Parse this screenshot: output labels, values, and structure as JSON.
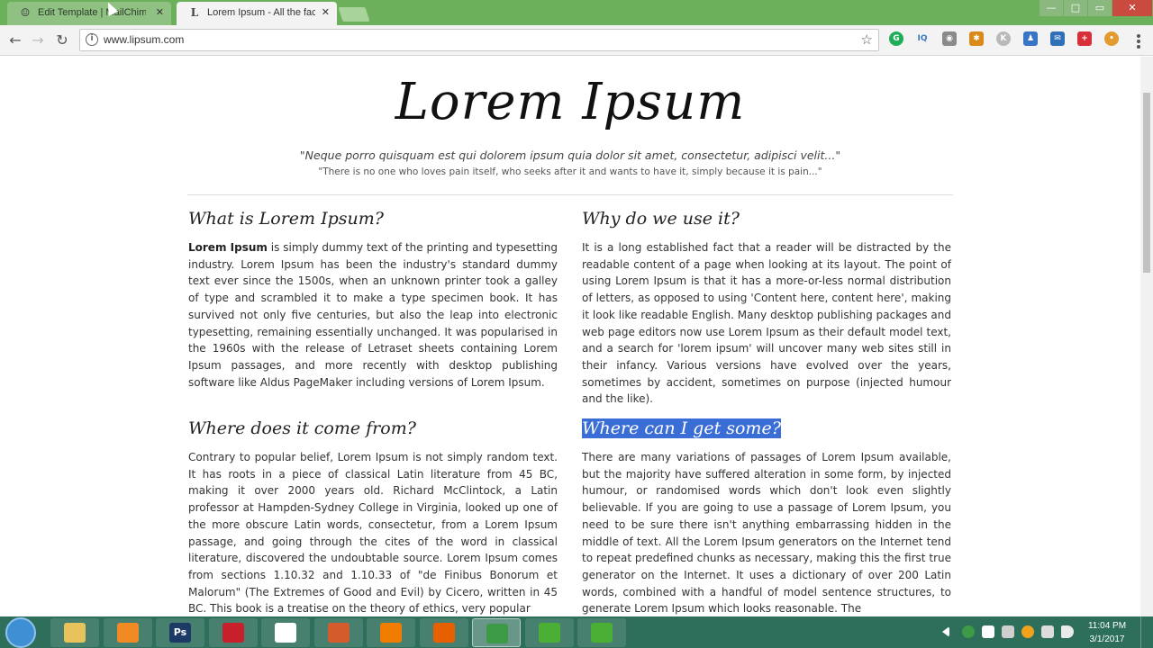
{
  "browser": {
    "tabs": [
      {
        "title": "Edit Template | MailChimp",
        "favicon": "mailchimp-icon",
        "active": false
      },
      {
        "title": "Lorem Ipsum - All the facts",
        "favicon": "L",
        "active": true
      }
    ],
    "close_glyph": "✕",
    "url": "www.lipsum.com",
    "window_controls": {
      "minimize": "—",
      "maximize": "□",
      "restore": "▭",
      "close": "✕"
    },
    "nav": {
      "back": "←",
      "forward": "→",
      "reload": "↻"
    },
    "extensions": [
      "grammarly-icon",
      "iq-icon",
      "camera-icon",
      "puzzle-icon",
      "k-icon",
      "user-icon",
      "mail-icon",
      "plus-icon",
      "cookie-icon"
    ],
    "extension_labels": {
      "iq": "IQ",
      "k": "K"
    }
  },
  "page": {
    "title": "Lorem Ipsum",
    "quote_latin": "\"Neque porro quisquam est qui dolorem ipsum quia dolor sit amet, consectetur, adipisci velit...\"",
    "quote_english": "\"There is no one who loves pain itself, who seeks after it and wants to have it, simply because it is pain...\"",
    "sections": [
      {
        "heading": "What is Lorem Ipsum?",
        "lead": "Lorem Ipsum",
        "body": " is simply dummy text of the printing and typesetting industry. Lorem Ipsum has been the industry's standard dummy text ever since the 1500s, when an unknown printer took a galley of type and scrambled it to make a type specimen book. It has survived not only five centuries, but also the leap into electronic typesetting, remaining essentially unchanged. It was popularised in the 1960s with the release of Letraset sheets containing Lorem Ipsum passages, and more recently with desktop publishing software like Aldus PageMaker including versions of Lorem Ipsum."
      },
      {
        "heading": "Why do we use it?",
        "body": "It is a long established fact that a reader will be distracted by the readable content of a page when looking at its layout. The point of using Lorem Ipsum is that it has a more-or-less normal distribution of letters, as opposed to using 'Content here, content here', making it look like readable English. Many desktop publishing packages and web page editors now use Lorem Ipsum as their default model text, and a search for 'lorem ipsum' will uncover many web sites still in their infancy. Various versions have evolved over the years, sometimes by accident, sometimes on purpose (injected humour and the like)."
      },
      {
        "heading": "Where does it come from?",
        "body": "Contrary to popular belief, Lorem Ipsum is not simply random text. It has roots in a piece of classical Latin literature from 45 BC, making it over 2000 years old. Richard McClintock, a Latin professor at Hampden-Sydney College in Virginia, looked up one of the more obscure Latin words, consectetur, from a Lorem Ipsum passage, and going through the cites of the word in classical literature, discovered the undoubtable source. Lorem Ipsum comes from sections 1.10.32 and 1.10.33 of \"de Finibus Bonorum et Malorum\" (The Extremes of Good and Evil) by Cicero, written in 45 BC. This book is a treatise on the theory of ethics, very popular"
      },
      {
        "heading": "Where can I get some?",
        "highlighted": true,
        "body": "There are many variations of passages of Lorem Ipsum available, but the majority have suffered alteration in some form, by injected humour, or randomised words which don't look even slightly believable. If you are going to use a passage of Lorem Ipsum, you need to be sure there isn't anything embarrassing hidden in the middle of text. All the Lorem Ipsum generators on the Internet tend to repeat predefined chunks as necessary, making this the first true generator on the Internet. It uses a dictionary of over 200 Latin words, combined with a handful of model sentence structures, to generate Lorem Ipsum which looks reasonable. The"
      }
    ]
  },
  "taskbar": {
    "items": [
      {
        "name": "explorer-icon",
        "color": "#e8c25a"
      },
      {
        "name": "media-player-icon",
        "color": "#f08a24"
      },
      {
        "name": "photoshop-icon",
        "color": "#1d3a67",
        "label": "Ps"
      },
      {
        "name": "downloader-icon",
        "color": "#c8202a"
      },
      {
        "name": "star-app-icon",
        "color": "#ffffff"
      },
      {
        "name": "image-viewer-icon",
        "color": "#d45b2c"
      },
      {
        "name": "vlc-icon",
        "color": "#f07c00"
      },
      {
        "name": "firefox-icon",
        "color": "#e66000"
      },
      {
        "name": "chrome-icon",
        "color": "#3d9b48"
      },
      {
        "name": "camtasia-icon",
        "color": "#4caf35"
      },
      {
        "name": "camtasia-recorder-icon",
        "color": "#4caf35"
      }
    ],
    "clock_time": "11:04 PM",
    "clock_date": "3/1/2017"
  },
  "colors": {
    "tabstrip": "#6cb05c",
    "taskbar": "#2e6f5c",
    "highlight": "#3a6ed6"
  }
}
